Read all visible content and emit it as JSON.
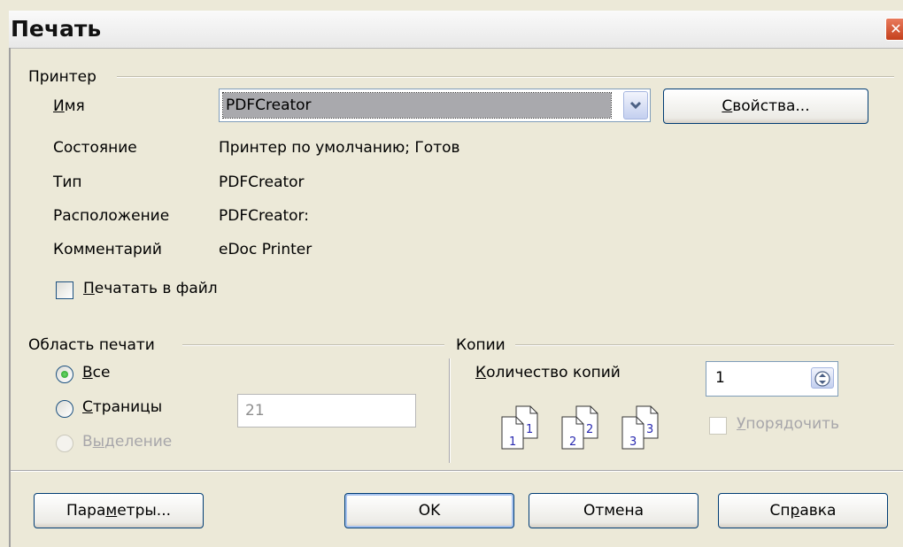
{
  "window": {
    "title": "Печать",
    "close_icon": "close-icon"
  },
  "printer": {
    "section_label": "Принтер",
    "name_label": "Имя",
    "name_value": "PDFCreator",
    "properties_button": "Свойства...",
    "status_label": "Состояние",
    "status_value": "Принтер по умолчанию; Готов",
    "type_label": "Тип",
    "type_value": "PDFCreator",
    "location_label": "Расположение",
    "location_value": "PDFCreator:",
    "comment_label": "Комментарий",
    "comment_value": "eDoc Printer",
    "print_to_file_label": "Печатать в файл",
    "print_to_file_checked": false
  },
  "print_range": {
    "section_label": "Область печати",
    "all_label": "Все",
    "all_selected": true,
    "pages_label": "Страницы",
    "pages_value": "21",
    "selection_label": "Выделение",
    "selection_enabled": false
  },
  "copies": {
    "section_label": "Копии",
    "count_label": "Количество копий",
    "count_value": "1",
    "collate_label": "Упорядочить",
    "collate_enabled": false,
    "collate_icon_numbers": [
      "1",
      "1",
      "2",
      "2",
      "3",
      "3"
    ]
  },
  "buttons": {
    "options": "Параметры...",
    "ok": "OK",
    "cancel": "Отмена",
    "help": "Справка"
  },
  "colors": {
    "dialog_bg": "#ece9d8",
    "selection_bg": "#a9a9ad",
    "radio_dot": "#21a121",
    "button_border": "#003c74"
  }
}
